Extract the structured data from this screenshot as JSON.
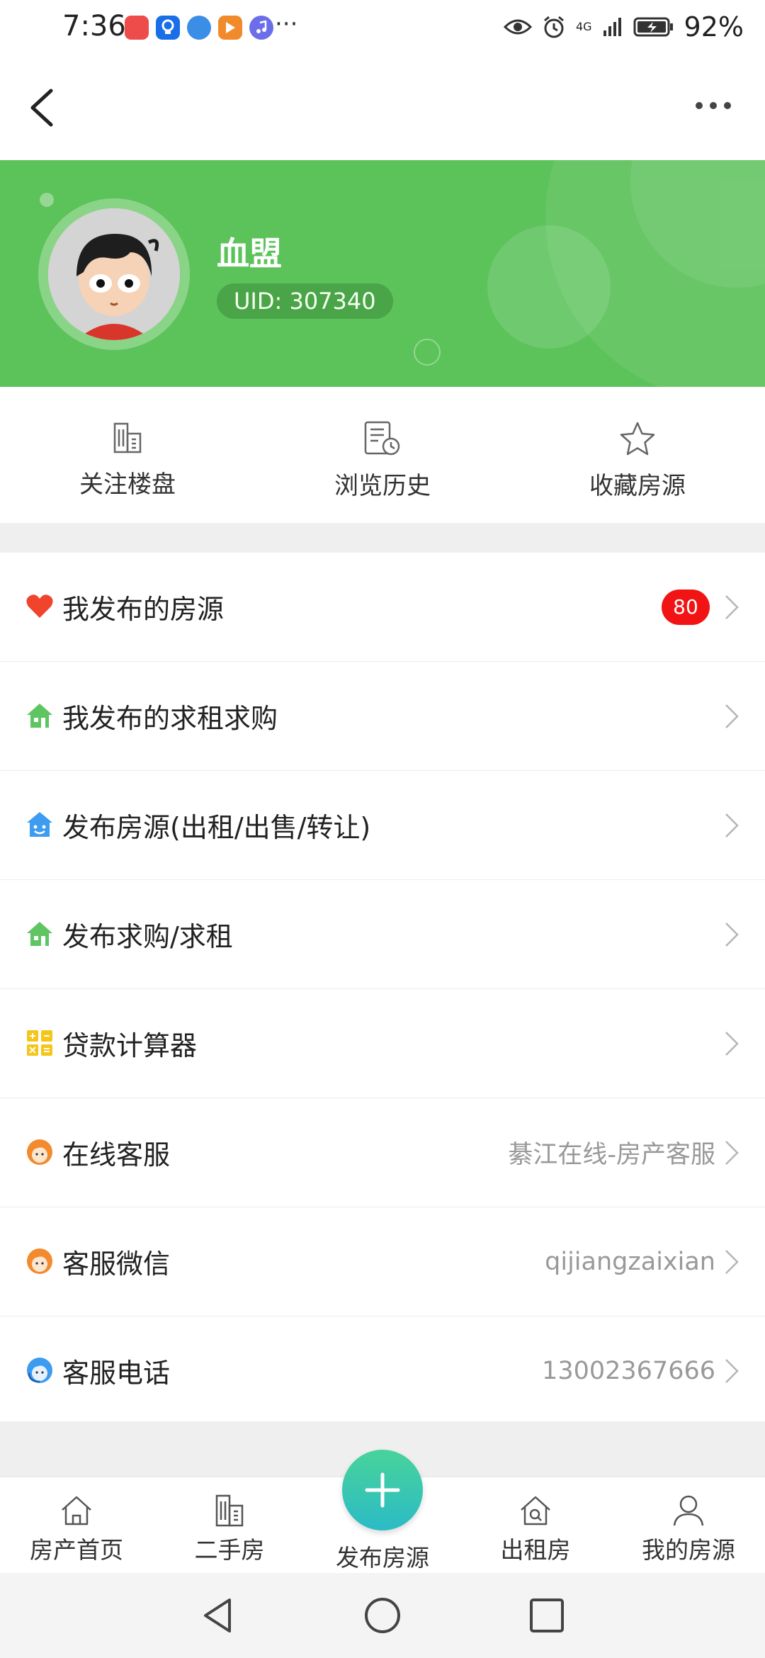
{
  "status_bar": {
    "time": "7:36",
    "more": "···",
    "network": "4G",
    "battery": "92%"
  },
  "profile": {
    "username": "血盟",
    "uid": "UID: 307340"
  },
  "quick_actions": [
    {
      "label": "关注楼盘",
      "icon": "building-icon"
    },
    {
      "label": "浏览历史",
      "icon": "history-document-icon"
    },
    {
      "label": "收藏房源",
      "icon": "star-icon"
    }
  ],
  "menu": [
    {
      "title": "我发布的房源",
      "icon": "heart-icon",
      "badge": "80",
      "value": ""
    },
    {
      "title": "我发布的求租求购",
      "icon": "house-icon",
      "value": ""
    },
    {
      "title": "发布房源(出租/出售/转让)",
      "icon": "smiling-house-icon",
      "value": ""
    },
    {
      "title": "发布求购/求租",
      "icon": "house-icon",
      "value": ""
    },
    {
      "title": "贷款计算器",
      "icon": "calculator-icon",
      "value": ""
    },
    {
      "title": "在线客服",
      "icon": "service-agent-icon",
      "value": "綦江在线-房产客服"
    },
    {
      "title": "客服微信",
      "icon": "service-agent-icon",
      "value": "qijiangzaixian"
    },
    {
      "title": "客服电话",
      "icon": "headset-agent-icon",
      "value": "13002367666"
    }
  ],
  "tabbar": {
    "home": "房产首页",
    "second_hand": "二手房",
    "publish": "发布房源",
    "rent": "出租房",
    "mine": "我的房源"
  },
  "colors": {
    "header_green": "#5cc25a",
    "badge_red": "#f21414",
    "fab_gradient": [
      "#48d39a",
      "#2bbbc6"
    ]
  }
}
